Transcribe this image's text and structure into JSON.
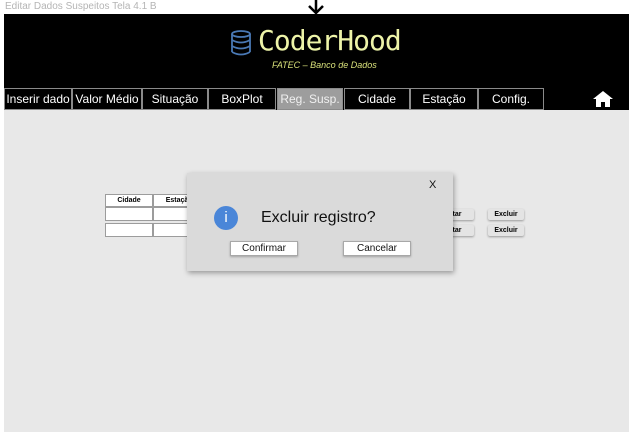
{
  "frame": {
    "title": "Editar Dados Suspeitos Tela 4.1 B"
  },
  "brand": {
    "name": "CoderHood",
    "subtitle": "FATEC – Banco de Dados"
  },
  "nav": {
    "tabs": [
      {
        "label": "Inserir dado",
        "active": false
      },
      {
        "label": "Valor Médio",
        "active": false
      },
      {
        "label": "Situação",
        "active": false
      },
      {
        "label": "BoxPlot",
        "active": false
      },
      {
        "label": "Reg. Susp.",
        "active": true
      },
      {
        "label": "Cidade",
        "active": false
      },
      {
        "label": "Estação",
        "active": false
      },
      {
        "label": "Config.",
        "active": false
      }
    ],
    "home_icon": "home-icon"
  },
  "table": {
    "headers": [
      "Cidade",
      "Estaçã"
    ],
    "row_actions": [
      {
        "edit": "itar",
        "delete": "Excluir"
      },
      {
        "edit": "itar",
        "delete": "Excluir"
      }
    ]
  },
  "dialog": {
    "close_label": "X",
    "icon_glyph": "i",
    "message": "Excluir registro?",
    "confirm_label": "Confirmar",
    "cancel_label": "Cancelar"
  },
  "colors": {
    "accent_active_tab": "#9d9d9d",
    "logo_text": "#eef4a8",
    "info_icon": "#4a86d8"
  }
}
